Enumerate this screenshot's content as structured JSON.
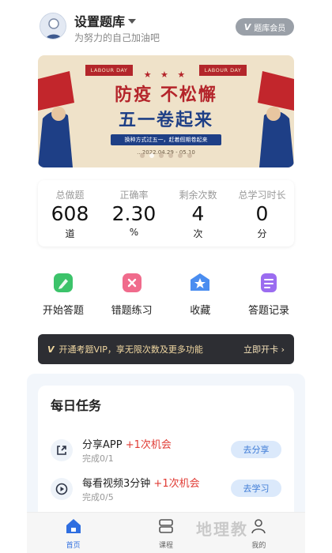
{
  "header": {
    "title": "设置题库",
    "subtitle": "为努力的自己加油吧",
    "member_badge_v": "V",
    "member_badge": "题库会员"
  },
  "banner": {
    "tag_left": "LABOUR DAY",
    "tag_right": "LABOUR DAY",
    "stars": "★ ★ ★",
    "line1": "防疫 不松懈",
    "line2": "五一卷起来",
    "pill": "换种方式过五一，赶着假期卷起来",
    "date": "...2022.04.29 - 05.10",
    "slide_count": 6,
    "active_slide": 1
  },
  "stats": [
    {
      "label": "总做题",
      "value": "608",
      "unit": "道"
    },
    {
      "label": "正确率",
      "value": "2.30",
      "unit": "%"
    },
    {
      "label": "剩余次数",
      "value": "4",
      "unit": "次"
    },
    {
      "label": "总学习时长",
      "value": "0",
      "unit": "分"
    }
  ],
  "actions": [
    {
      "label": "开始答题",
      "icon": "pencil-icon",
      "color": "#3cc36a"
    },
    {
      "label": "错题练习",
      "icon": "wrong-icon",
      "color": "#f06b8c"
    },
    {
      "label": "收藏",
      "icon": "star-icon",
      "color": "#4a8df0"
    },
    {
      "label": "答题记录",
      "icon": "record-icon",
      "color": "#9b6cf0"
    }
  ],
  "vip": {
    "v": "V",
    "text": "开通考题VIP，享无限次数及更多功能",
    "cta": "立即开卡 ›"
  },
  "daily_tasks": {
    "title": "每日任务",
    "items": [
      {
        "name": "分享APP",
        "bonus": "+1次机会",
        "progress": "完成0/1",
        "button": "去分享",
        "icon": "share-icon"
      },
      {
        "name": "每看视频3分钟",
        "bonus": "+1次机会",
        "progress": "完成0/5",
        "button": "去学习",
        "icon": "play-icon"
      }
    ]
  },
  "bottom_nav": [
    {
      "label": "首页",
      "icon": "home-icon",
      "active": true
    },
    {
      "label": "课程",
      "icon": "course-icon",
      "active": false
    },
    {
      "label": "我的",
      "icon": "profile-icon",
      "active": false
    }
  ],
  "watermark": "地理教",
  "colors": {
    "accent": "#2f6ee0",
    "bonus_red": "#e03b34",
    "vip_bg": "#2d2e33",
    "vip_text": "#f1d8a2"
  }
}
